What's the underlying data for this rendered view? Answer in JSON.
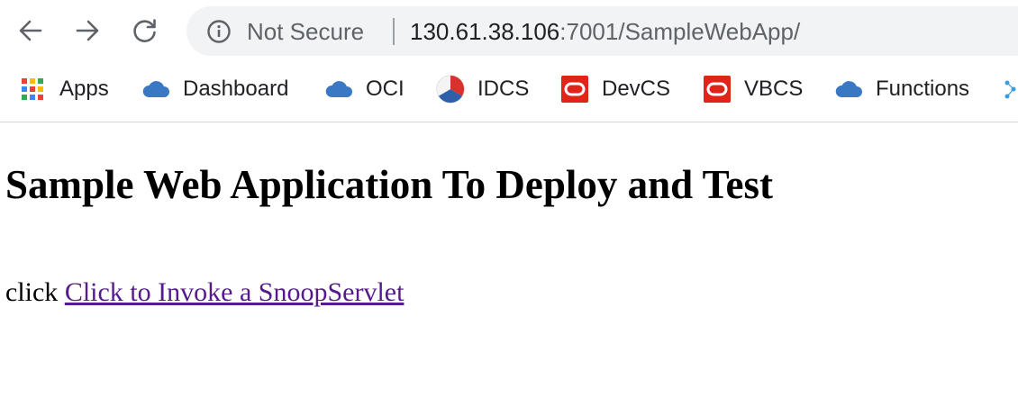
{
  "browser": {
    "security_label": "Not Secure",
    "url_host": "130.61.38.106",
    "url_path": ":7001/SampleWebApp/"
  },
  "bookmarks": [
    {
      "label": "Apps",
      "icon": "apps-grid-icon"
    },
    {
      "label": "Dashboard",
      "icon": "cloud-icon"
    },
    {
      "label": "OCI",
      "icon": "cloud-icon"
    },
    {
      "label": "IDCS",
      "icon": "idcs-logo-icon"
    },
    {
      "label": "DevCS",
      "icon": "oracle-logo-icon"
    },
    {
      "label": "VBCS",
      "icon": "oracle-logo-icon"
    },
    {
      "label": "Functions",
      "icon": "cloud-icon"
    }
  ],
  "page": {
    "heading": "Sample Web Application To Deploy and Test",
    "line_prefix": "click ",
    "link_text": "Click to Invoke a SnoopServlet"
  },
  "colors": {
    "link_visited": "#551a8b",
    "cloud_blue": "#3b78c4",
    "oracle_red": "#e2231a",
    "omnibox_bg": "#f1f3f4"
  }
}
